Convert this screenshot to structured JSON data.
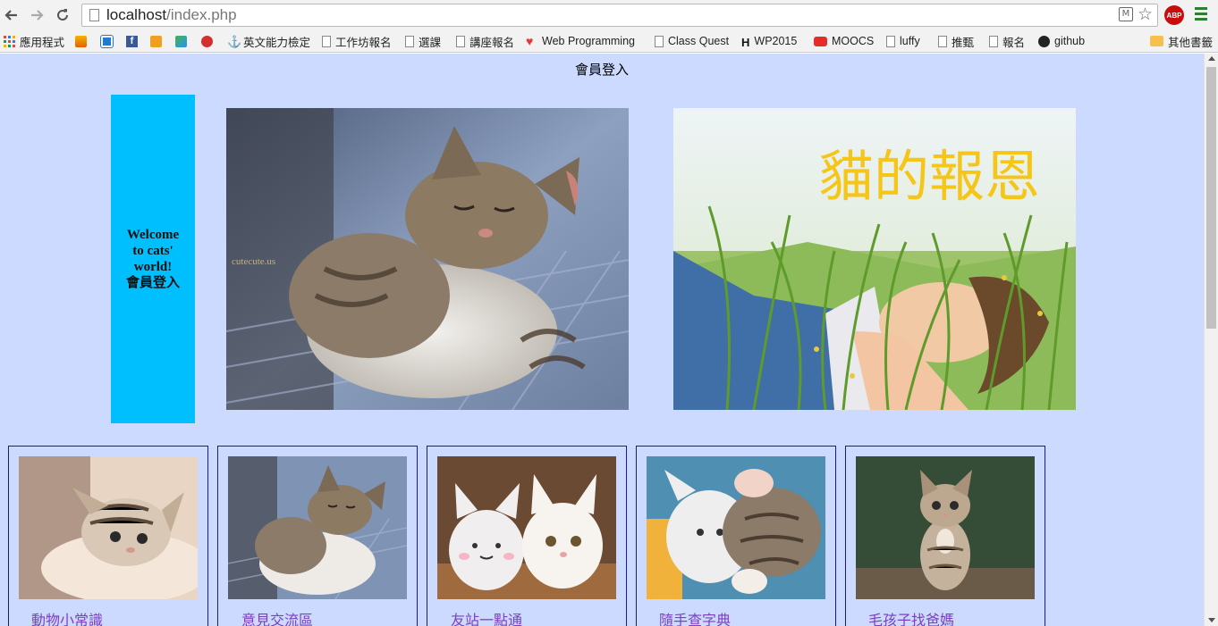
{
  "browser": {
    "url_host": "localhost",
    "url_path": "/index.php",
    "back_icon": "arrow-left-icon",
    "forward_icon": "arrow-right-icon",
    "reload_icon": "reload-icon",
    "abp_label": "ABP",
    "bookmarks": [
      {
        "label": "應用程式",
        "icon": "apps-icon"
      },
      {
        "label": "",
        "icon": "pma-icon"
      },
      {
        "label": "",
        "icon": "d-icon"
      },
      {
        "label": "",
        "icon": "facebook-icon"
      },
      {
        "label": "",
        "icon": "m-icon"
      },
      {
        "label": "",
        "icon": "stack-icon"
      },
      {
        "label": "",
        "icon": "flower-icon"
      },
      {
        "label": "英文能力檢定",
        "icon": "anchor-icon"
      },
      {
        "label": "工作坊報名",
        "icon": "page-icon"
      },
      {
        "label": "選課",
        "icon": "page-icon"
      },
      {
        "label": "講座報名",
        "icon": "page-icon"
      },
      {
        "label": "Web Programming",
        "icon": "heart-icon"
      },
      {
        "label": "Class Quest",
        "icon": "page-icon"
      },
      {
        "label": "WP2015",
        "icon": "h-icon"
      },
      {
        "label": "MOOCS",
        "icon": "youtube-icon"
      },
      {
        "label": "luffy",
        "icon": "page-icon"
      },
      {
        "label": "推甄",
        "icon": "page-icon"
      },
      {
        "label": "報名",
        "icon": "page-icon"
      },
      {
        "label": "github",
        "icon": "github-icon"
      }
    ],
    "other_bookmarks": "其他書籤"
  },
  "page": {
    "heading": "會員登入",
    "welcome_line1": "Welcome",
    "welcome_line2": "to cats'",
    "welcome_line3": "world!",
    "welcome_login": "會員登入",
    "hero1_watermark": "cutecute.us",
    "hero2_title": "貓的報恩",
    "cards": [
      {
        "caption": "動物小常識"
      },
      {
        "caption": "意見交流區"
      },
      {
        "caption": "友站一點通"
      },
      {
        "caption": "隨手查字典"
      },
      {
        "caption": "毛孩子找爸媽"
      }
    ],
    "colors": {
      "page_bg": "#ccdaff",
      "welcome_bg": "#00bfff",
      "card_border": "#1a1aa0",
      "caption_link": "#7d3fbf",
      "hero2_title": "#f5c518"
    }
  }
}
